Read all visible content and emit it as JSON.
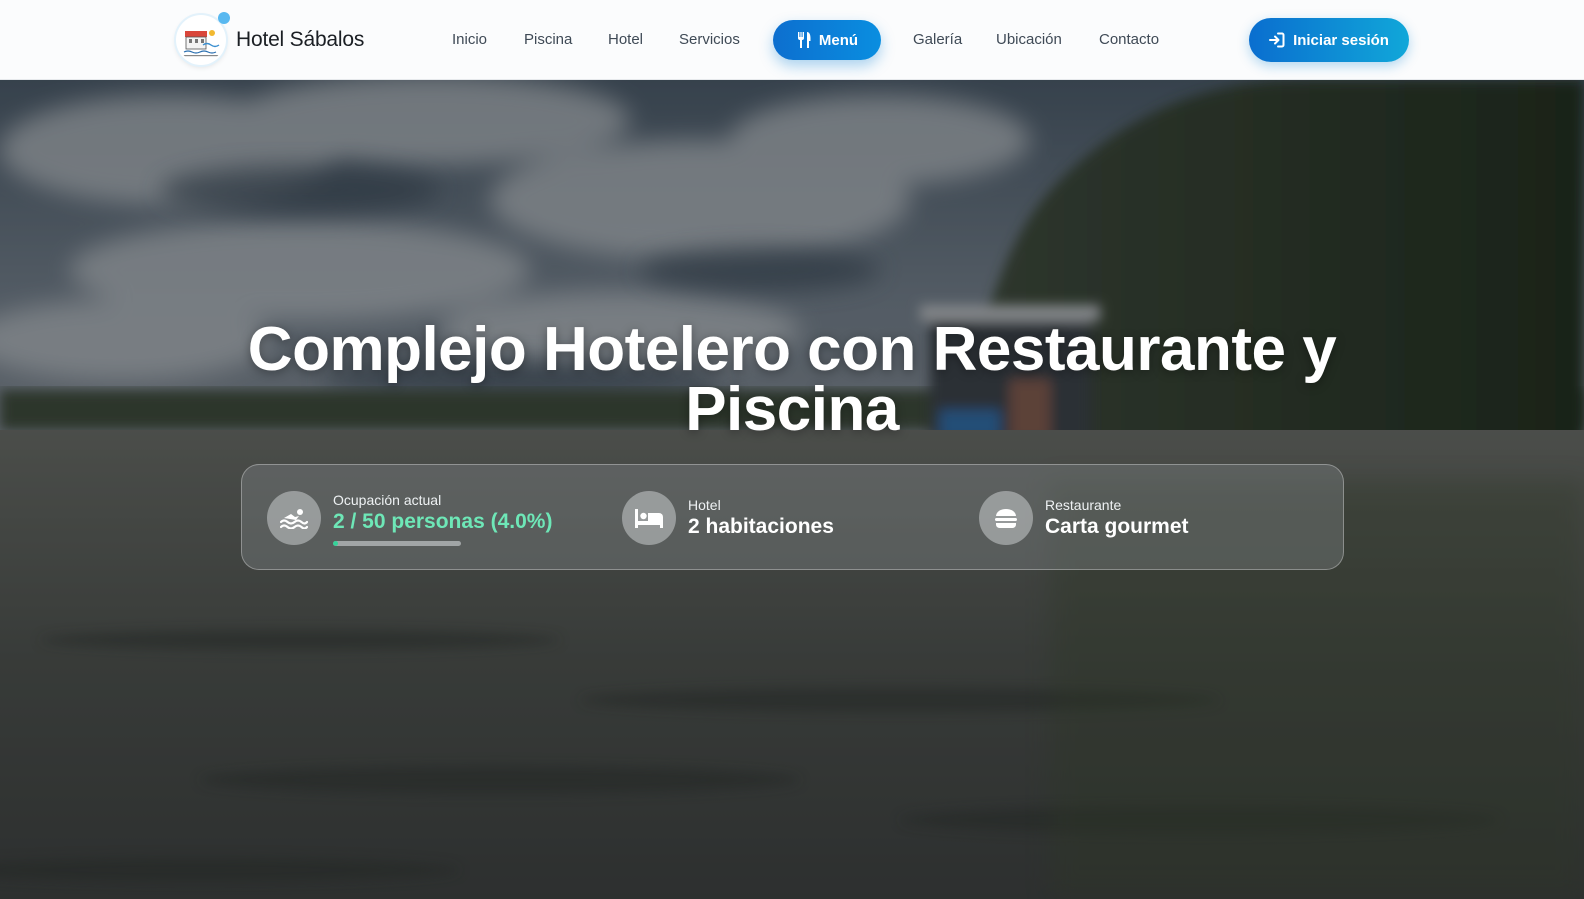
{
  "brand": {
    "name": "Hotel Sábalos",
    "logo": "hotel-logo"
  },
  "nav": {
    "links": [
      "Inicio",
      "Piscina",
      "Hotel",
      "Servicios",
      "Galería",
      "Ubicación",
      "Contacto"
    ],
    "menu_button": "Menú",
    "login_button": "Iniciar sesión"
  },
  "hero": {
    "title_line1": "Complejo Hotelero con Restaurante y",
    "title_line2": "Piscina"
  },
  "stats": {
    "occupancy": {
      "label": "Ocupación actual",
      "value": "2 / 50 personas (4.0%)",
      "progress": 0.04,
      "icon": "swimmer-icon"
    },
    "hotel": {
      "label": "Hotel",
      "value": "2 habitaciones",
      "icon": "bed-icon"
    },
    "restaurant": {
      "label": "Restaurante",
      "value": "Carta gourmet",
      "icon": "burger-icon"
    }
  },
  "colors": {
    "primary": "#0a7fd6",
    "accent_green": "#6ee7b7",
    "nav_text": "#3f4a56"
  }
}
